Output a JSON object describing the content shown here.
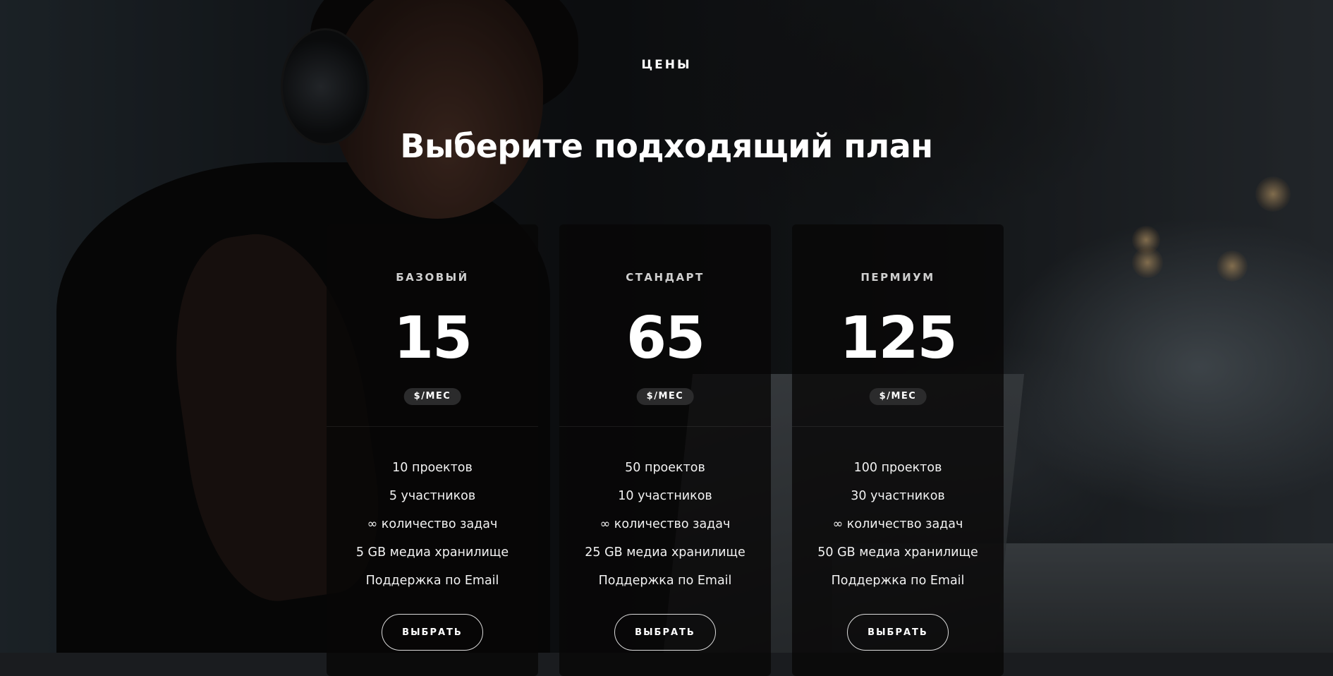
{
  "section": {
    "eyebrow": "ЦЕНЫ",
    "title": "Выберите подходящий план"
  },
  "plans": [
    {
      "name": "БАЗОВЫЙ",
      "price": "15",
      "unit": "$/МЕС",
      "features": [
        "10 проектов",
        "5 участников",
        "∞ количество задач",
        "5 GB медиа хранилище",
        "Поддержка по Email"
      ],
      "button_label": "ВЫБРАТЬ"
    },
    {
      "name": "СТАНДАРТ",
      "price": "65",
      "unit": "$/МЕС",
      "features": [
        "50 проектов",
        "10 участников",
        "∞ количество задач",
        "25 GB медиа хранилище",
        "Поддержка по Email"
      ],
      "button_label": "ВЫБРАТЬ"
    },
    {
      "name": "ПЕРМИУМ",
      "price": "125",
      "unit": "$/МЕС",
      "features": [
        "100 проектов",
        "30 участников",
        "∞ количество задач",
        "50 GB медиа хранилище",
        "Поддержка по Email"
      ],
      "button_label": "ВЫБРАТЬ"
    }
  ]
}
